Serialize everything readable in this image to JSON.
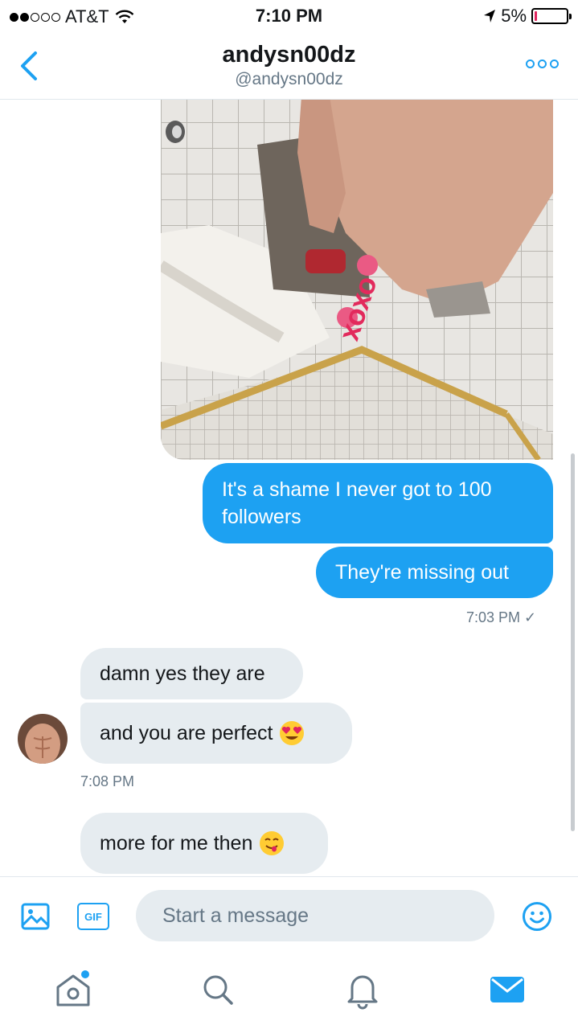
{
  "status_bar": {
    "carrier": "AT&T",
    "time": "7:10 PM",
    "battery": "5%",
    "battery_level": 0.05
  },
  "header": {
    "title": "andysn00dz",
    "subtitle": "@andysn00dz"
  },
  "messages": {
    "sent_1": "It's a shame I never got to 100",
    "sent_1b": "followers",
    "sent_2": "They're missing out",
    "sent_time": "7:03 PM ✓",
    "recv_1": "damn yes they are",
    "recv_2": "and you are perfect",
    "recv_time": "7:08 PM",
    "recv_3": "more for me then"
  },
  "composer": {
    "gif_label": "GIF",
    "placeholder": "Start a message"
  },
  "colors": {
    "accent": "#1da1f2",
    "incoming_bubble": "#e6ecf0",
    "secondary_text": "#657786"
  },
  "icons": {
    "back": "chevron-left-icon",
    "more": "more-icon",
    "media": "image-icon",
    "emoji": "smiley-icon",
    "tabs": [
      "home-icon",
      "search-icon",
      "notifications-icon",
      "messages-icon"
    ]
  }
}
